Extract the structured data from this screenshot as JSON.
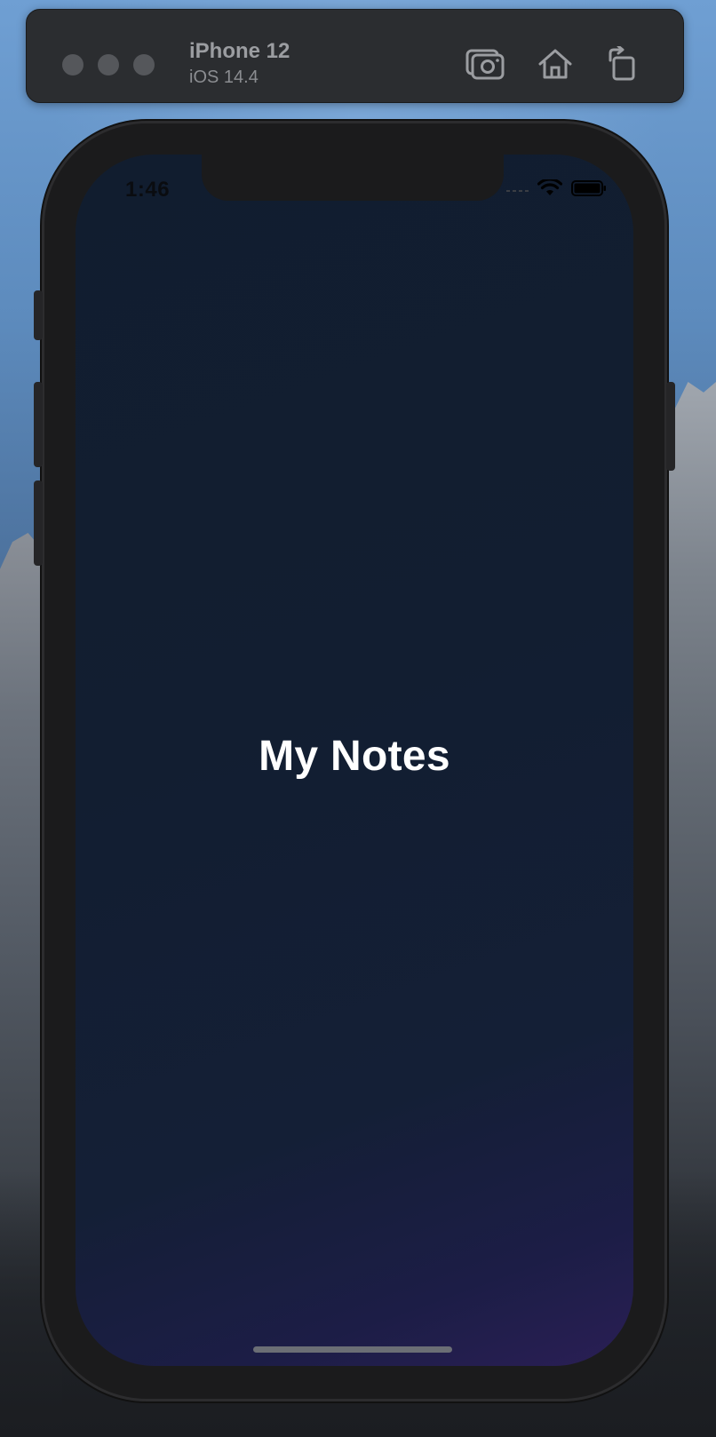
{
  "simulator": {
    "device_name": "iPhone 12",
    "os_version": "iOS 14.4",
    "toolbar_icons": [
      "screenshot-icon",
      "home-icon",
      "rotate-icon"
    ]
  },
  "status_bar": {
    "time": "1:46"
  },
  "app": {
    "title": "My Notes"
  },
  "colors": {
    "screen_bg": "#121e31",
    "screen_bg_accent": "#2a1f55",
    "title_text": "#ffffff"
  }
}
